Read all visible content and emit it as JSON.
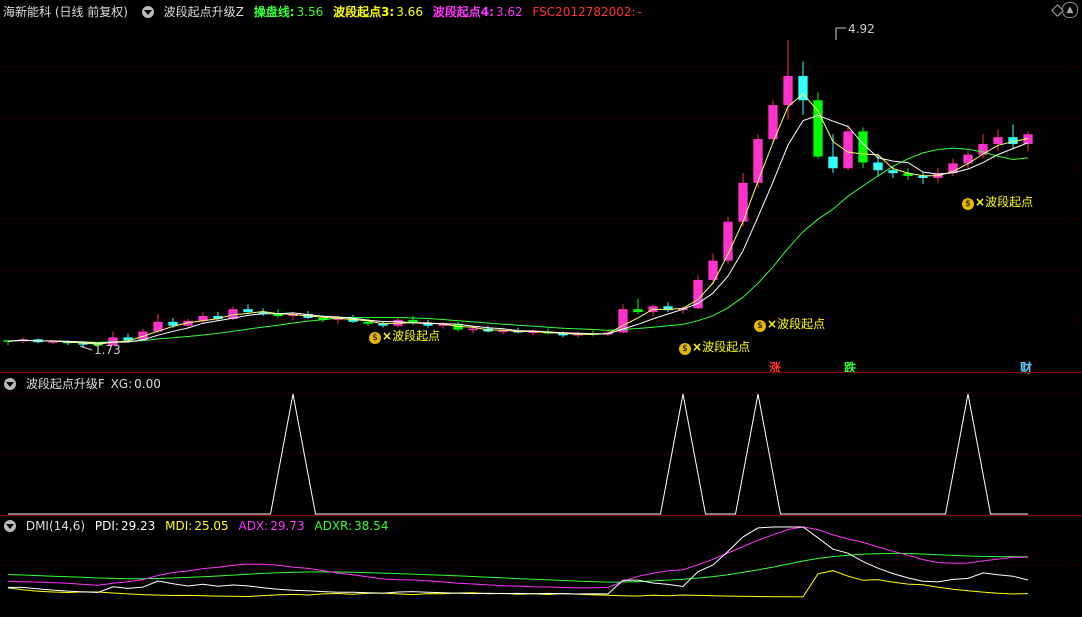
{
  "main_header": {
    "stock": "海新能科 (日线 前复权)",
    "indicator": "波段起点升级Z",
    "line1_label": "操盘线:",
    "line1_value": "3.56",
    "line2_label": "波段起点3:",
    "line2_value": "3.66",
    "line3_label": "波段起点4:",
    "line3_value": "3.62",
    "line4_label": "FSC2012782002:",
    "line4_value": "-"
  },
  "sub1_header": {
    "indicator": "波段起点升级F",
    "xg_label": "XG:",
    "xg_value": "0.00"
  },
  "sub2_header": {
    "indicator": "DMI(14,6)",
    "pdi_label": "PDI:",
    "pdi_value": "29.23",
    "mdi_label": "MDI:",
    "mdi_value": "25.05",
    "adx_label": "ADX:",
    "adx_value": "29.73",
    "adxr_label": "ADXR:",
    "adxr_value": "38.54"
  },
  "price_labels": {
    "high": "4.92",
    "low": "1.73"
  },
  "signal_label": "波段起点",
  "signal_icon": "money-bag-icon",
  "markers": {
    "zhang": "涨",
    "die": "跌",
    "cai": "财"
  },
  "colors": {
    "up": "#ff33cc",
    "down": "#33ffff",
    "down2": "#00ff00",
    "yang_red": "#ff3333",
    "ma_yellow": "#ffff66",
    "ma_green": "#33ff33",
    "pdi": "#ffffff",
    "mdi": "#ffff00",
    "adx": "#ff33ff",
    "adxr": "#33ff33",
    "xg": "#ffffff"
  },
  "chart_data": {
    "type": "candlestick",
    "price_range": [
      1.73,
      4.92
    ],
    "candles": [
      [
        1.83,
        1.83,
        1.78,
        1.82
      ],
      [
        1.82,
        1.86,
        1.8,
        1.84
      ],
      [
        1.84,
        1.85,
        1.8,
        1.81
      ],
      [
        1.81,
        1.83,
        1.79,
        1.82
      ],
      [
        1.82,
        1.83,
        1.78,
        1.8
      ],
      [
        1.8,
        1.81,
        1.75,
        1.79
      ],
      [
        1.79,
        1.8,
        1.73,
        1.78
      ],
      [
        1.78,
        1.92,
        1.77,
        1.86
      ],
      [
        1.86,
        1.9,
        1.82,
        1.83
      ],
      [
        1.83,
        1.95,
        1.83,
        1.92
      ],
      [
        1.92,
        2.1,
        1.9,
        2.02
      ],
      [
        2.02,
        2.06,
        1.96,
        1.98
      ],
      [
        1.98,
        2.05,
        1.95,
        2.03
      ],
      [
        2.03,
        2.12,
        2.0,
        2.08
      ],
      [
        2.08,
        2.12,
        2.03,
        2.05
      ],
      [
        2.05,
        2.18,
        2.04,
        2.15
      ],
      [
        2.15,
        2.2,
        2.1,
        2.12
      ],
      [
        2.12,
        2.16,
        2.08,
        2.11
      ],
      [
        2.11,
        2.15,
        2.06,
        2.08
      ],
      [
        2.08,
        2.12,
        2.04,
        2.1
      ],
      [
        2.1,
        2.13,
        2.05,
        2.06
      ],
      [
        2.06,
        2.09,
        2.02,
        2.04
      ],
      [
        2.04,
        2.08,
        2.0,
        2.07
      ],
      [
        2.07,
        2.09,
        2.01,
        2.02
      ],
      [
        2.02,
        2.05,
        1.98,
        2.0
      ],
      [
        2.0,
        2.03,
        1.96,
        1.98
      ],
      [
        1.98,
        2.06,
        1.96,
        2.04
      ],
      [
        2.04,
        2.08,
        1.99,
        2.01
      ],
      [
        2.01,
        2.04,
        1.96,
        1.98
      ],
      [
        1.98,
        2.02,
        1.95,
        2.0
      ],
      [
        2.0,
        2.02,
        1.92,
        1.94
      ],
      [
        1.94,
        1.97,
        1.9,
        1.95
      ],
      [
        1.95,
        1.98,
        1.91,
        1.92
      ],
      [
        1.92,
        1.95,
        1.89,
        1.93
      ],
      [
        1.93,
        1.96,
        1.9,
        1.91
      ],
      [
        1.91,
        1.94,
        1.88,
        1.92
      ],
      [
        1.92,
        1.95,
        1.89,
        1.9
      ],
      [
        1.9,
        1.92,
        1.86,
        1.88
      ],
      [
        1.88,
        1.92,
        1.86,
        1.9
      ],
      [
        1.9,
        1.93,
        1.87,
        1.89
      ],
      [
        1.89,
        1.93,
        1.87,
        1.91
      ],
      [
        1.91,
        2.2,
        1.9,
        2.15
      ],
      [
        2.15,
        2.26,
        2.1,
        2.12
      ],
      [
        2.12,
        2.2,
        2.08,
        2.18
      ],
      [
        2.18,
        2.22,
        2.12,
        2.14
      ],
      [
        2.14,
        2.18,
        2.1,
        2.16
      ],
      [
        2.16,
        2.5,
        2.15,
        2.45
      ],
      [
        2.45,
        2.72,
        2.4,
        2.65
      ],
      [
        2.65,
        3.1,
        2.62,
        3.05
      ],
      [
        3.05,
        3.55,
        3.0,
        3.45
      ],
      [
        3.45,
        3.95,
        3.4,
        3.9
      ],
      [
        3.9,
        4.3,
        3.85,
        4.25
      ],
      [
        4.25,
        4.92,
        4.1,
        4.55
      ],
      [
        4.55,
        4.7,
        4.15,
        4.3
      ],
      [
        4.3,
        4.38,
        3.7,
        3.72
      ],
      [
        3.72,
        3.95,
        3.55,
        3.6
      ],
      [
        3.6,
        4.05,
        3.58,
        3.98
      ],
      [
        3.98,
        4.02,
        3.6,
        3.66
      ],
      [
        3.66,
        3.75,
        3.52,
        3.58
      ],
      [
        3.58,
        3.62,
        3.5,
        3.55
      ],
      [
        3.55,
        3.6,
        3.48,
        3.52
      ],
      [
        3.52,
        3.56,
        3.44,
        3.5
      ],
      [
        3.5,
        3.6,
        3.45,
        3.55
      ],
      [
        3.55,
        3.7,
        3.52,
        3.65
      ],
      [
        3.65,
        3.78,
        3.6,
        3.74
      ],
      [
        3.74,
        3.95,
        3.7,
        3.85
      ],
      [
        3.85,
        4.0,
        3.78,
        3.92
      ],
      [
        3.92,
        4.05,
        3.8,
        3.85
      ],
      [
        3.85,
        3.98,
        3.78,
        3.95
      ]
    ],
    "xg_signals": [
      19,
      45,
      50,
      64
    ],
    "dmi": {
      "pdi": 29.23,
      "mdi": 25.05,
      "adx": 29.73,
      "adxr": 38.54
    }
  }
}
